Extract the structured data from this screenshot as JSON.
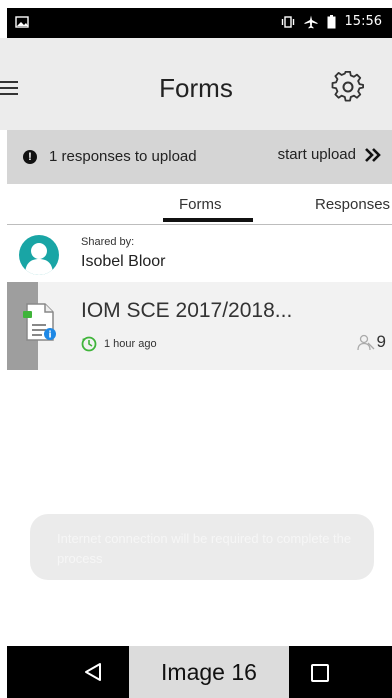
{
  "status_bar": {
    "time": "15:56",
    "icons": [
      "image-icon",
      "vibrate-icon",
      "airplane-icon",
      "battery-icon"
    ]
  },
  "header": {
    "title": "Forms",
    "menu_icon": "hamburger-menu-icon",
    "settings_icon": "gear-icon"
  },
  "upload_banner": {
    "message": "1 responses to upload",
    "action_label": "start upload",
    "action_icon": "double-chevron-right-icon"
  },
  "tabs": [
    {
      "label": "Forms",
      "active": true
    },
    {
      "label": "Responses",
      "active": false
    }
  ],
  "shared": {
    "label": "Shared by:",
    "name": "Isobel Bloor"
  },
  "form_item": {
    "title": "IOM SCE 2017/2018...",
    "time_ago": "1 hour ago",
    "response_count": "9"
  },
  "toast": {
    "message": "Internet connection will be required to complete the process"
  },
  "nav_bar": {
    "caption": "Image 16"
  },
  "colors": {
    "appbar": "#ececec",
    "upload_bar": "#d5d5d5",
    "avatar": "#19a5a5",
    "accent_green": "#3fb43a",
    "info_blue": "#1e88e5"
  }
}
